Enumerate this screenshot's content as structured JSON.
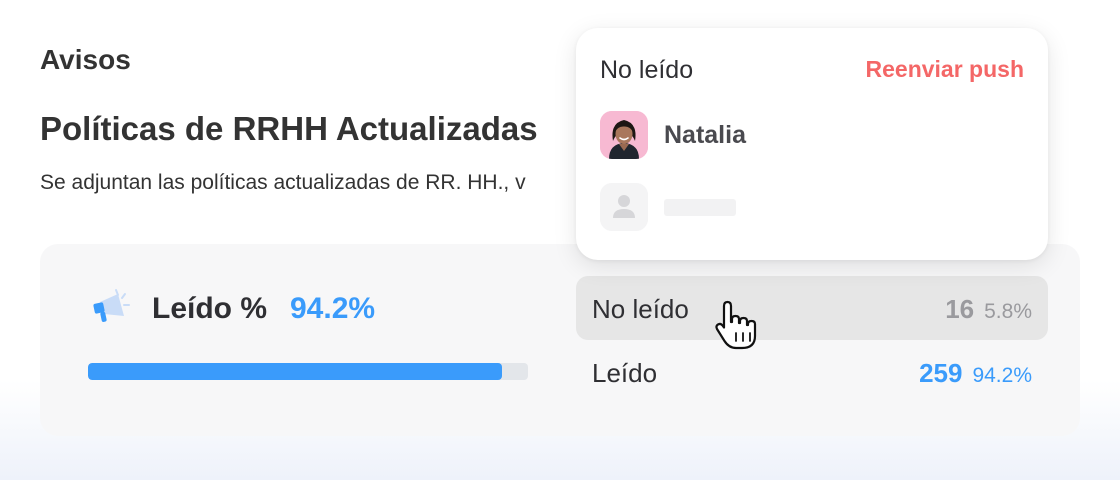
{
  "section": {
    "title": "Avisos"
  },
  "notice": {
    "title": "Políticas de RRHH Actualizadas",
    "body": "Se adjuntan las políticas actualizadas de RR. HH., v"
  },
  "stats": {
    "rate_label": "Leído %",
    "rate_value": "94.2%",
    "progress": 0.942,
    "rows": [
      {
        "label": "No leído",
        "count": "16",
        "pct": "5.8%"
      },
      {
        "label": "Leído",
        "count": "259",
        "pct": "94.2%"
      }
    ]
  },
  "popover": {
    "title": "No leído",
    "resend_label": "Reenviar push",
    "users": [
      {
        "name": "Natalia"
      }
    ]
  },
  "colors": {
    "accent": "#3a9bfb",
    "resend": "#f46767",
    "muted": "#9a9a9e"
  },
  "icons": [
    "megaphone-icon",
    "avatar-placeholder-icon",
    "hand-pointer-cursor-icon"
  ]
}
